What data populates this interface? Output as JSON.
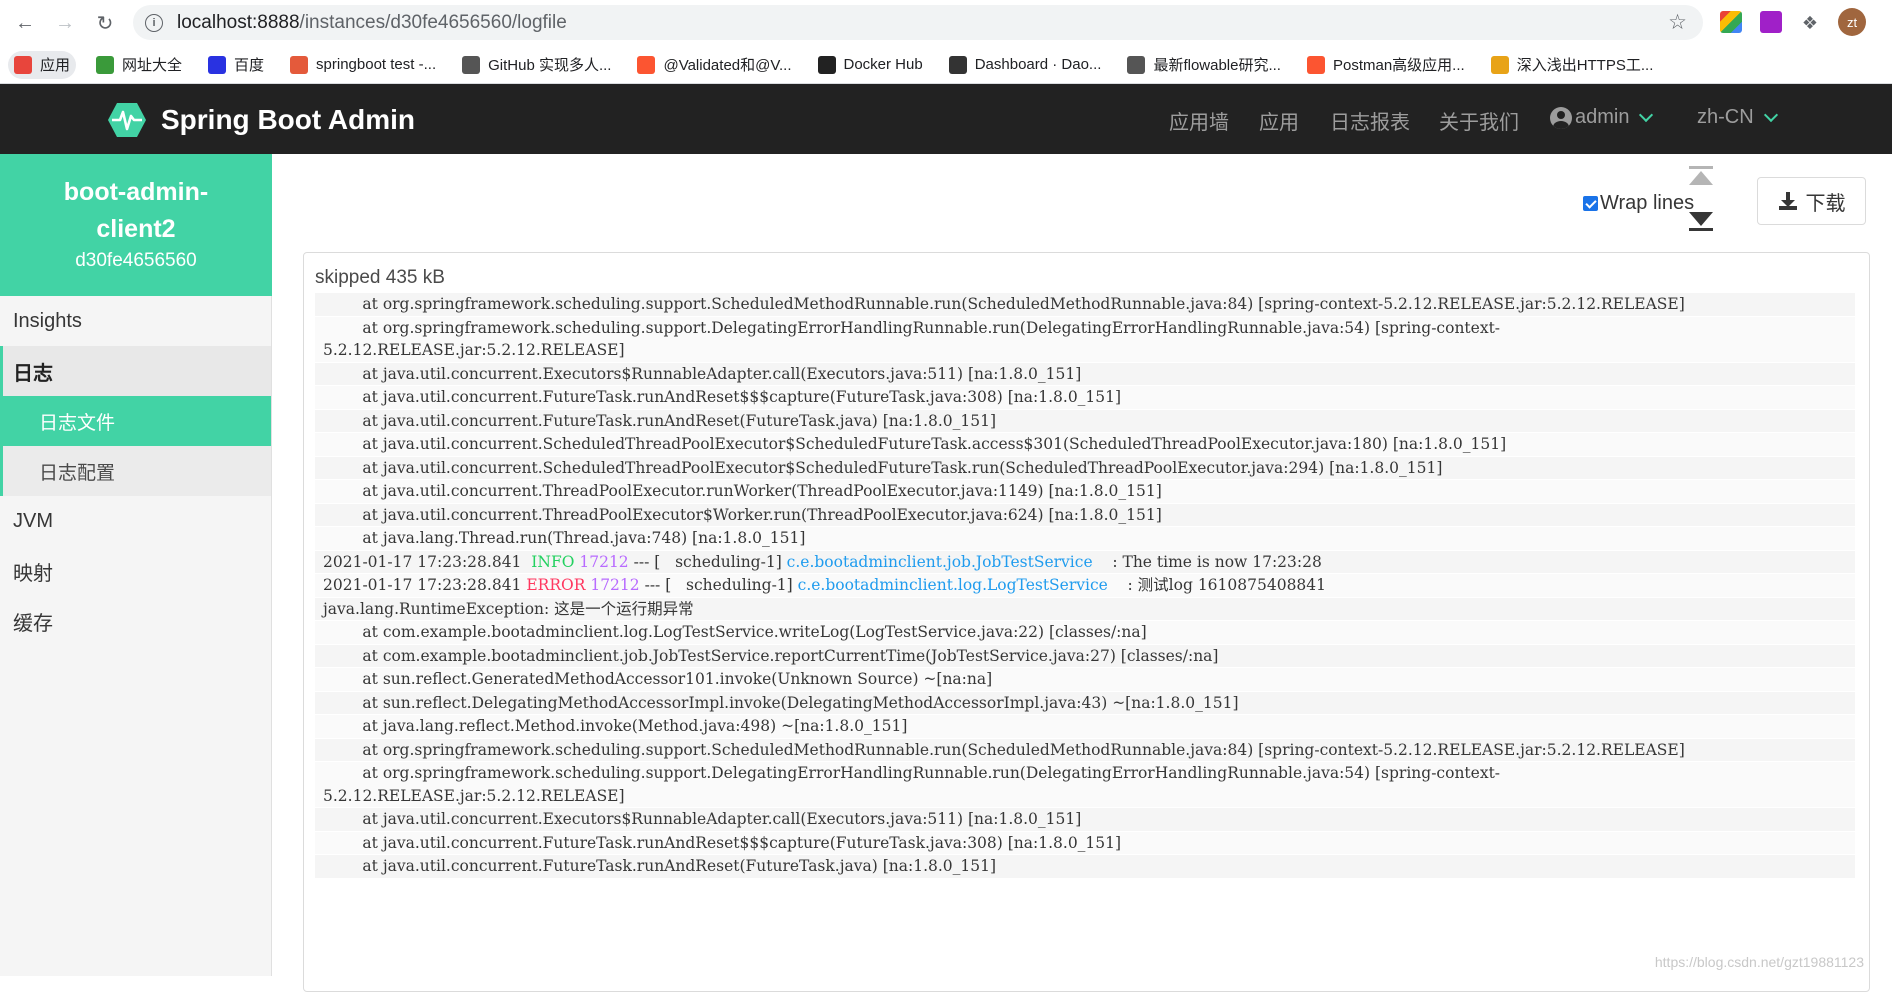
{
  "browser": {
    "url_host": "localhost:8888",
    "url_path": "/instances/d30fe4656560/logfile",
    "profile_initials": "zt",
    "bookmarks": [
      {
        "label": "应用",
        "color": "#e8453c",
        "icon": "apps-icon"
      },
      {
        "label": "网址大全",
        "color": "#3a9a3a",
        "icon": "hao-icon"
      },
      {
        "label": "百度",
        "color": "#2932e1",
        "icon": "baidu-icon"
      },
      {
        "label": "springboot test -...",
        "color": "#e45a3b",
        "icon": "jianshu-icon"
      },
      {
        "label": "GitHub 实现多人...",
        "color": "#555555",
        "icon": "flask-icon"
      },
      {
        "label": "@Validated和@V...",
        "color": "#fc5531",
        "icon": "csdn-icon"
      },
      {
        "label": "Docker Hub",
        "color": "#222222",
        "icon": "docker-icon"
      },
      {
        "label": "Dashboard · Dao...",
        "color": "#333333",
        "icon": "github-icon"
      },
      {
        "label": "最新flowable研究...",
        "color": "#555555",
        "icon": "flask-icon"
      },
      {
        "label": "Postman高级应用...",
        "color": "#fc5531",
        "icon": "csdn-icon"
      },
      {
        "label": "深入浅出HTTPS工...",
        "color": "#e8a317",
        "icon": "s-icon"
      }
    ]
  },
  "header": {
    "brand": "Spring Boot Admin",
    "nav": [
      "应用墙",
      "应用",
      "日志报表",
      "关于我们"
    ],
    "user": "admin",
    "locale": "zh-CN",
    "accent": "#42d3a5"
  },
  "sidebar": {
    "app_name": "boot-admin-client2",
    "instance_id": "d30fe4656560",
    "items": {
      "insights": "Insights",
      "logs": "日志",
      "logfile": "日志文件",
      "loglevel": "日志配置",
      "jvm": "JVM",
      "mappings": "映射",
      "caches": "缓存"
    }
  },
  "main": {
    "wrap_lines_label": "Wrap lines",
    "wrap_lines_checked": true,
    "download_label": "下载",
    "skipped_text": "skipped 435 kB",
    "log_lines": [
      {
        "text": "        at org.springframework.scheduling.support.ScheduledMethodRunnable.run(ScheduledMethodRunnable.java:84) [spring-context-5.2.12.RELEASE.jar:5.2.12.RELEASE]"
      },
      {
        "text": "        at org.springframework.scheduling.support.DelegatingErrorHandlingRunnable.run(DelegatingErrorHandlingRunnable.java:54) [spring-context-\n5.2.12.RELEASE.jar:5.2.12.RELEASE]"
      },
      {
        "text": "        at java.util.concurrent.Executors$RunnableAdapter.call(Executors.java:511) [na:1.8.0_151]"
      },
      {
        "text": "        at java.util.concurrent.FutureTask.runAndReset$$$capture(FutureTask.java:308) [na:1.8.0_151]"
      },
      {
        "text": "        at java.util.concurrent.FutureTask.runAndReset(FutureTask.java) [na:1.8.0_151]"
      },
      {
        "text": "        at java.util.concurrent.ScheduledThreadPoolExecutor$ScheduledFutureTask.access$301(ScheduledThreadPoolExecutor.java:180) [na:1.8.0_151]"
      },
      {
        "text": "        at java.util.concurrent.ScheduledThreadPoolExecutor$ScheduledFutureTask.run(ScheduledThreadPoolExecutor.java:294) [na:1.8.0_151]"
      },
      {
        "text": "        at java.util.concurrent.ThreadPoolExecutor.runWorker(ThreadPoolExecutor.java:1149) [na:1.8.0_151]"
      },
      {
        "text": "        at java.util.concurrent.ThreadPoolExecutor$Worker.run(ThreadPoolExecutor.java:624) [na:1.8.0_151]"
      },
      {
        "text": "        at java.lang.Thread.run(Thread.java:748) [na:1.8.0_151]"
      },
      {
        "ts": "2021-01-17 17:23:28.841 ",
        "level": " INFO",
        "pid": " 17212",
        "mid": " --- [   scheduling-1] ",
        "logger": "c.e.bootadminclient.job.JobTestService    ",
        "msg": ": The time is now 17:23:28"
      },
      {
        "ts": "2021-01-17 17:23:28.841 ",
        "level": "ERROR",
        "pid": " 17212",
        "mid": " --- [   scheduling-1] ",
        "logger": "c.e.bootadminclient.log.LogTestService    ",
        "msg": ": 测试log 1610875408841"
      },
      {
        "text": "java.lang.RuntimeException: 这是一个运行期异常"
      },
      {
        "text": "        at com.example.bootadminclient.log.LogTestService.writeLog(LogTestService.java:22) [classes/:na]"
      },
      {
        "text": "        at com.example.bootadminclient.job.JobTestService.reportCurrentTime(JobTestService.java:27) [classes/:na]"
      },
      {
        "text": "        at sun.reflect.GeneratedMethodAccessor101.invoke(Unknown Source) ~[na:na]"
      },
      {
        "text": "        at sun.reflect.DelegatingMethodAccessorImpl.invoke(DelegatingMethodAccessorImpl.java:43) ~[na:1.8.0_151]"
      },
      {
        "text": "        at java.lang.reflect.Method.invoke(Method.java:498) ~[na:1.8.0_151]"
      },
      {
        "text": "        at org.springframework.scheduling.support.ScheduledMethodRunnable.run(ScheduledMethodRunnable.java:84) [spring-context-5.2.12.RELEASE.jar:5.2.12.RELEASE]"
      },
      {
        "text": "        at org.springframework.scheduling.support.DelegatingErrorHandlingRunnable.run(DelegatingErrorHandlingRunnable.java:54) [spring-context-\n5.2.12.RELEASE.jar:5.2.12.RELEASE]"
      },
      {
        "text": "        at java.util.concurrent.Executors$RunnableAdapter.call(Executors.java:511) [na:1.8.0_151]"
      },
      {
        "text": "        at java.util.concurrent.FutureTask.runAndReset$$$capture(FutureTask.java:308) [na:1.8.0_151]"
      },
      {
        "text": "        at java.util.concurrent.FutureTask.runAndReset(FutureTask.java) [na:1.8.0_151]"
      }
    ]
  },
  "watermark": "https://blog.csdn.net/gzt19881123"
}
